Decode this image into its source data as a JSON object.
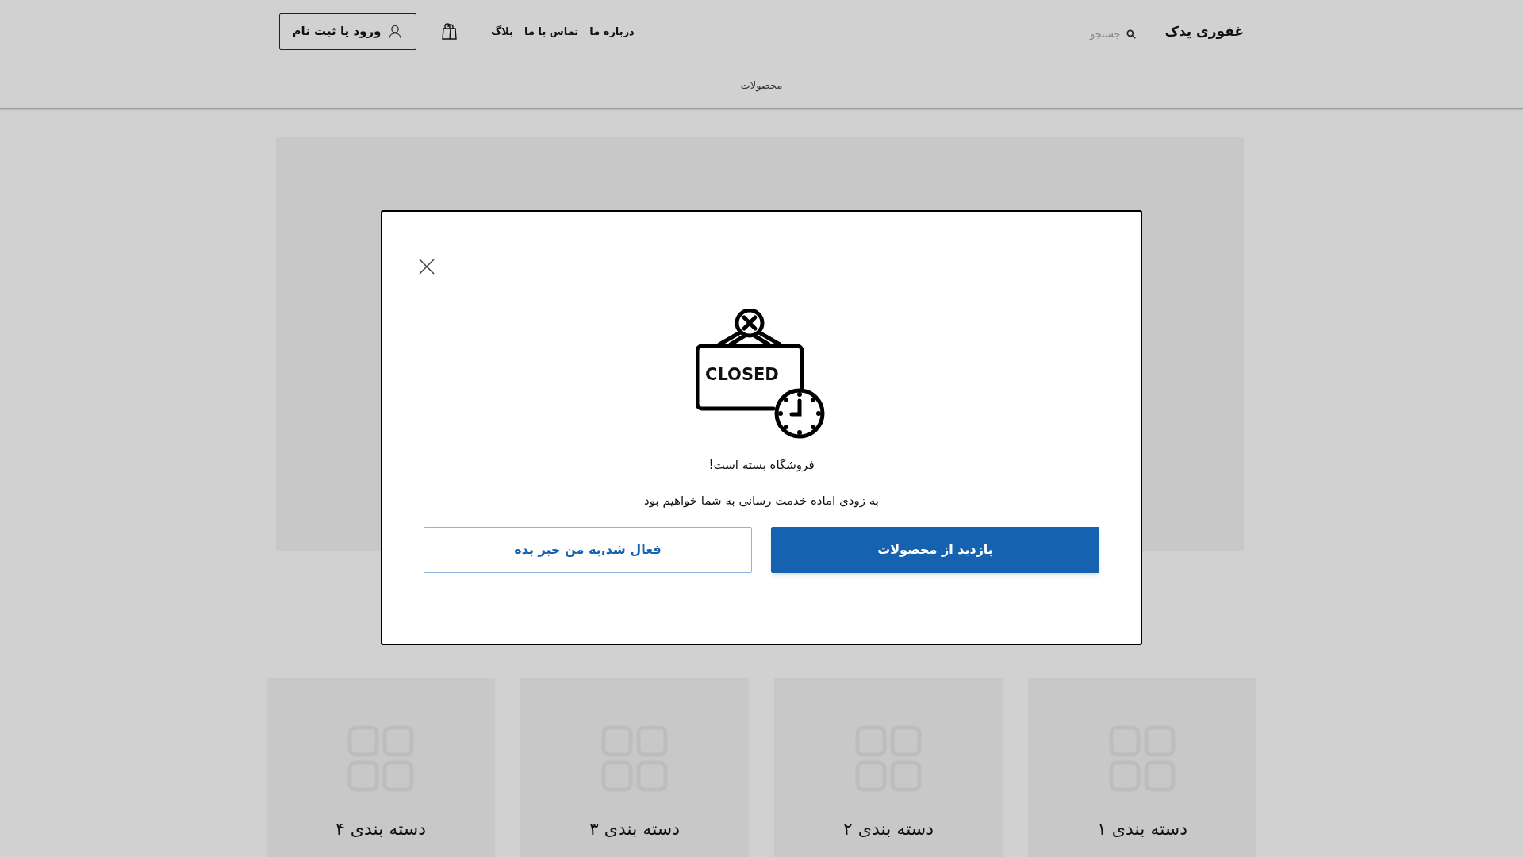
{
  "header": {
    "logo": "غفوری یدک",
    "search": {
      "placeholder": "جستجو"
    },
    "nav": [
      "درباره ما",
      "تماس با ما",
      "بلاگ"
    ],
    "login_button": "ورود یا ثبت نام"
  },
  "subnav": {
    "items": [
      "محصولات"
    ]
  },
  "categories": [
    {
      "label": "دسته بندی ۱"
    },
    {
      "label": "دسته بندی ۲"
    },
    {
      "label": "دسته بندی ۳"
    },
    {
      "label": "دسته بندی ۴"
    }
  ],
  "modal": {
    "sign_text": "CLOSED",
    "title": "فروشگاه بسته است!",
    "message": "به زودی اماده خدمت رسانی به شما خواهیم بود",
    "buttons": [
      {
        "label": "بازدید از محصولات",
        "kind": "primary"
      },
      {
        "label": "فعال شد,به من خبر بده",
        "kind": "outline"
      }
    ]
  }
}
